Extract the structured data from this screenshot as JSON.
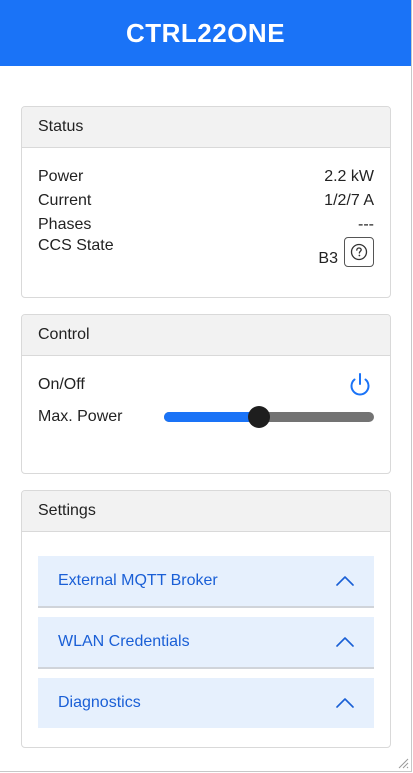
{
  "app": {
    "title": "CTRL22ONE"
  },
  "status": {
    "title": "Status",
    "rows": [
      {
        "label": "Power",
        "value": "2.2 kW"
      },
      {
        "label": "Current",
        "value": "1/2/7 A"
      },
      {
        "label": "Phases",
        "value": "---"
      }
    ],
    "ccs": {
      "label": "CCS State",
      "value": "B3",
      "help_icon": "question-circle-icon"
    }
  },
  "control": {
    "title": "Control",
    "onoff_label": "On/Off",
    "onoff_icon": "power-icon",
    "maxpower_label": "Max. Power",
    "maxpower_level": 0.45
  },
  "settings": {
    "title": "Settings",
    "items": [
      {
        "label": "External MQTT Broker",
        "icon": "chevron-up-icon"
      },
      {
        "label": "WLAN Credentials",
        "icon": "chevron-up-icon"
      },
      {
        "label": "Diagnostics",
        "icon": "chevron-up-icon"
      }
    ]
  },
  "colors": {
    "brand": "#1a73f7",
    "accordion_bg": "#e6f0fd",
    "accordion_text": "#1a5fd6",
    "slider_thumb": "#1e1e1e",
    "slider_track": "#737373"
  }
}
